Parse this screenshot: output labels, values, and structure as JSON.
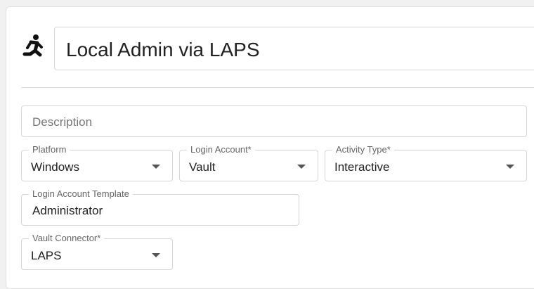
{
  "header": {
    "icon": "running-person-icon",
    "title": "Local Admin via LAPS"
  },
  "description": {
    "placeholder": "Description",
    "value": ""
  },
  "platform": {
    "label": "Platform",
    "value": "Windows"
  },
  "login_account": {
    "label": "Login Account*",
    "value": "Vault"
  },
  "activity_type": {
    "label": "Activity Type*",
    "value": "Interactive"
  },
  "login_account_template": {
    "label": "Login Account Template",
    "value": "Administrator"
  },
  "vault_connector": {
    "label": "Vault Connector*",
    "value": "LAPS"
  }
}
